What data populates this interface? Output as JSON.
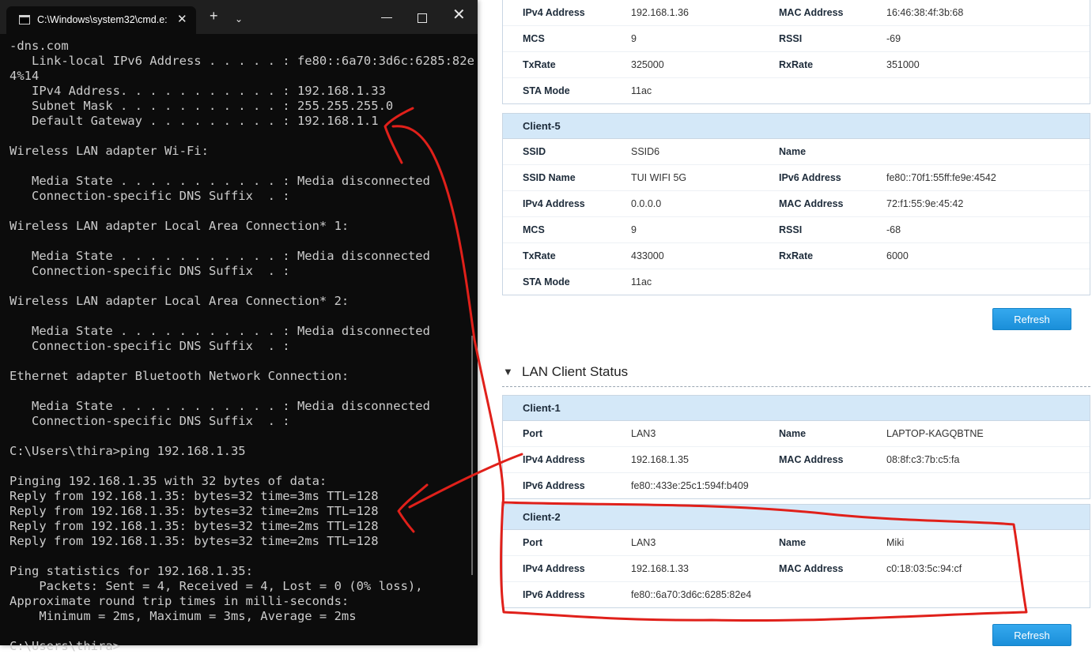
{
  "terminal": {
    "tab_title": "C:\\Windows\\system32\\cmd.e:",
    "new_tab_label": "+",
    "lines": [
      "-dns.com",
      "   Link-local IPv6 Address . . . . . : fe80::6a70:3d6c:6285:82e",
      "4%14",
      "   IPv4 Address. . . . . . . . . . . : 192.168.1.33",
      "   Subnet Mask . . . . . . . . . . . : 255.255.255.0",
      "   Default Gateway . . . . . . . . . : 192.168.1.1",
      "",
      "Wireless LAN adapter Wi-Fi:",
      "",
      "   Media State . . . . . . . . . . . : Media disconnected",
      "   Connection-specific DNS Suffix  . :",
      "",
      "Wireless LAN adapter Local Area Connection* 1:",
      "",
      "   Media State . . . . . . . . . . . : Media disconnected",
      "   Connection-specific DNS Suffix  . :",
      "",
      "Wireless LAN adapter Local Area Connection* 2:",
      "",
      "   Media State . . . . . . . . . . . : Media disconnected",
      "   Connection-specific DNS Suffix  . :",
      "",
      "Ethernet adapter Bluetooth Network Connection:",
      "",
      "   Media State . . . . . . . . . . . : Media disconnected",
      "   Connection-specific DNS Suffix  . :",
      "",
      "C:\\Users\\thira>ping 192.168.1.35",
      "",
      "Pinging 192.168.1.35 with 32 bytes of data:",
      "Reply from 192.168.1.35: bytes=32 time=3ms TTL=128",
      "Reply from 192.168.1.35: bytes=32 time=2ms TTL=128",
      "Reply from 192.168.1.35: bytes=32 time=2ms TTL=128",
      "Reply from 192.168.1.35: bytes=32 time=2ms TTL=128",
      "",
      "Ping statistics for 192.168.1.35:",
      "    Packets: Sent = 4, Received = 4, Lost = 0 (0% loss),",
      "Approximate round trip times in milli-seconds:",
      "    Minimum = 2ms, Maximum = 3ms, Average = 2ms",
      "",
      "C:\\Users\\thira>"
    ]
  },
  "wlan_top": {
    "rows": [
      [
        "IPv4 Address",
        "192.168.1.36",
        "MAC Address",
        "16:46:38:4f:3b:68"
      ],
      [
        "MCS",
        "9",
        "RSSI",
        "-69"
      ],
      [
        "TxRate",
        "325000",
        "RxRate",
        "351000"
      ],
      [
        "STA Mode",
        "11ac",
        "",
        ""
      ]
    ]
  },
  "wlan_client5": {
    "title": "Client-5",
    "rows": [
      [
        "SSID",
        "SSID6",
        "Name",
        ""
      ],
      [
        "SSID Name",
        "TUI WIFI 5G",
        "IPv6 Address",
        "fe80::70f1:55ff:fe9e:4542"
      ],
      [
        "IPv4 Address",
        "0.0.0.0",
        "MAC Address",
        "72:f1:55:9e:45:42"
      ],
      [
        "MCS",
        "9",
        "RSSI",
        "-68"
      ],
      [
        "TxRate",
        "433000",
        "RxRate",
        "6000"
      ],
      [
        "STA Mode",
        "11ac",
        "",
        ""
      ]
    ]
  },
  "refresh_label": "Refresh",
  "lan_section": {
    "title": "LAN Client Status",
    "toggle_glyph": "▼"
  },
  "lan_client1": {
    "title": "Client-1",
    "rows": [
      [
        "Port",
        "LAN3",
        "Name",
        "LAPTOP-KAGQBTNE"
      ],
      [
        "IPv4 Address",
        "192.168.1.35",
        "MAC Address",
        "08:8f:c3:7b:c5:fa"
      ],
      [
        "IPv6 Address",
        "fe80::433e:25c1:594f:b409",
        "",
        ""
      ]
    ]
  },
  "lan_client2": {
    "title": "Client-2",
    "rows": [
      [
        "Port",
        "LAN3",
        "Name",
        "Miki"
      ],
      [
        "IPv4 Address",
        "192.168.1.33",
        "MAC Address",
        "c0:18:03:5c:94:cf"
      ],
      [
        "IPv6 Address",
        "fe80::6a70:3d6c:6285:82e4",
        "",
        ""
      ]
    ]
  },
  "annotation_color": "#e0201a"
}
